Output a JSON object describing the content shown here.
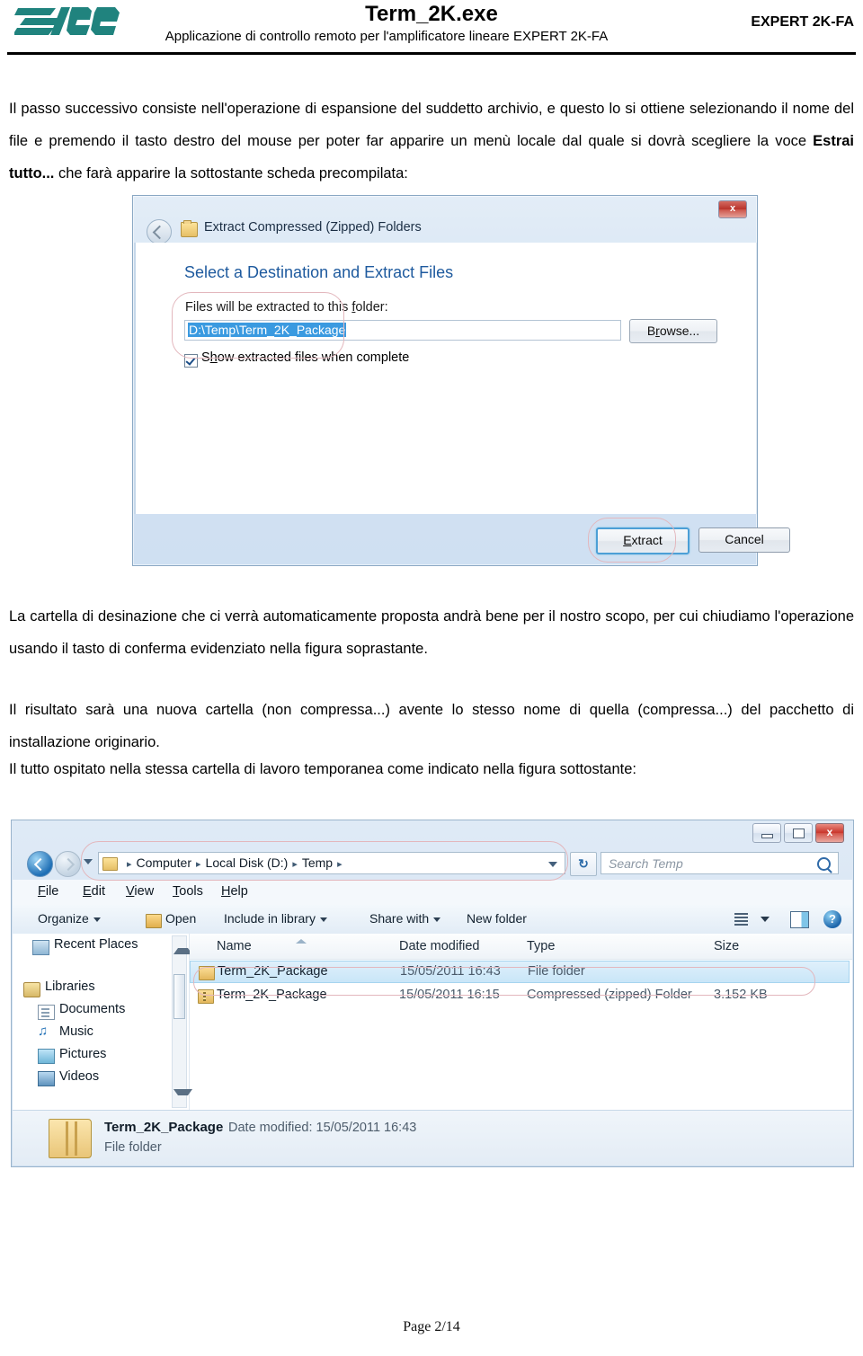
{
  "header": {
    "title": "Term_2K.exe",
    "subtitle": "Applicazione di controllo remoto per l'amplificatore lineare EXPERT 2K-FA",
    "right_label": "EXPERT 2K-FA",
    "logo_alt": "spe-logo"
  },
  "paragraphs": {
    "p1_a": "Il passo successivo consiste nell'operazione di espansione del suddetto archivio, e questo lo si ottiene selezionando il nome del file e premendo il tasto destro del mouse per poter far apparire un menù locale dal quale si dovrà scegliere la voce ",
    "p1_bold": "Estrai tutto...",
    "p1_b": " che farà apparire la sottostante scheda precompilata:",
    "p2": "La cartella di desinazione che ci verrà automaticamente proposta andrà bene per il nostro scopo, per cui chiudiamo l'operazione usando il tasto di conferma evidenziato nella figura soprastante.",
    "p3": "Il risultato sarà una nuova cartella (non compressa...) avente lo stesso nome di quella (compressa...) del pacchetto di installazione originario.",
    "p4": "Il tutto ospitato nella stessa cartella di lavoro temporanea come indicato nella figura sottostante:"
  },
  "extract_dialog": {
    "titlebar_text": "Extract Compressed (Zipped) Folders",
    "close_label": "x",
    "heading": "Select a Destination and Extract Files",
    "folder_label_pre": "Files will be extracted to this ",
    "folder_label_key": "f",
    "folder_label_post": "older:",
    "path_value": "D:\\Temp\\Term_2K_Package",
    "browse_pre": "B",
    "browse_key": "r",
    "browse_post": "owse...",
    "checkbox_pre": "S",
    "checkbox_key": "h",
    "checkbox_post": "ow extracted files when complete",
    "checkbox_checked": true,
    "extract_pre": "",
    "extract_key": "E",
    "extract_post": "xtract",
    "cancel_label": "Cancel",
    "highlight_color": "#e3b7bd"
  },
  "explorer": {
    "window_buttons": {
      "minimize": "minimize",
      "maximize": "maximize",
      "close": "x"
    },
    "breadcrumbs": [
      "Computer",
      "Local Disk (D:)",
      "Temp"
    ],
    "breadcrumb_separator": "▸",
    "refresh_label": "↻",
    "search_placeholder": "Search Temp",
    "menubar": [
      {
        "key": "F",
        "rest": "ile"
      },
      {
        "key": "E",
        "rest": "dit"
      },
      {
        "key": "V",
        "rest": "iew"
      },
      {
        "key": "T",
        "rest": "ools"
      },
      {
        "key": "H",
        "rest": "elp"
      }
    ],
    "toolbar": [
      {
        "label": "Organize",
        "caret": true
      },
      {
        "label": "Open",
        "caret": false
      },
      {
        "label": "Include in library",
        "caret": true
      },
      {
        "label": "Share with",
        "caret": true
      },
      {
        "label": "New folder",
        "caret": false
      }
    ],
    "help_label": "?",
    "nav_items": [
      {
        "label": "Recent Places",
        "icon": "recent-places-icon"
      },
      {
        "label": "Libraries",
        "icon": "libraries-folder-icon"
      },
      {
        "label": "Documents",
        "icon": "documents-icon"
      },
      {
        "label": "Music",
        "icon": "music-note-icon"
      },
      {
        "label": "Pictures",
        "icon": "pictures-icon"
      },
      {
        "label": "Videos",
        "icon": "videos-icon"
      }
    ],
    "columns": [
      "Name",
      "Date modified",
      "Type",
      "Size"
    ],
    "rows": [
      {
        "name": "Term_2K_Package",
        "date": "15/05/2011 16:43",
        "type": "File folder",
        "size": "",
        "selected": true,
        "icon": "folder-icon"
      },
      {
        "name": "Term_2K_Package",
        "date": "15/05/2011 16:15",
        "type": "Compressed (zipped) Folder",
        "size": "3.152 KB",
        "selected": false,
        "icon": "zipped-folder-icon"
      }
    ],
    "details": {
      "name": "Term_2K_Package",
      "meta": "Date modified: 15/05/2011 16:43",
      "type": "File folder"
    }
  },
  "footer": {
    "page": "Page 2/14"
  }
}
